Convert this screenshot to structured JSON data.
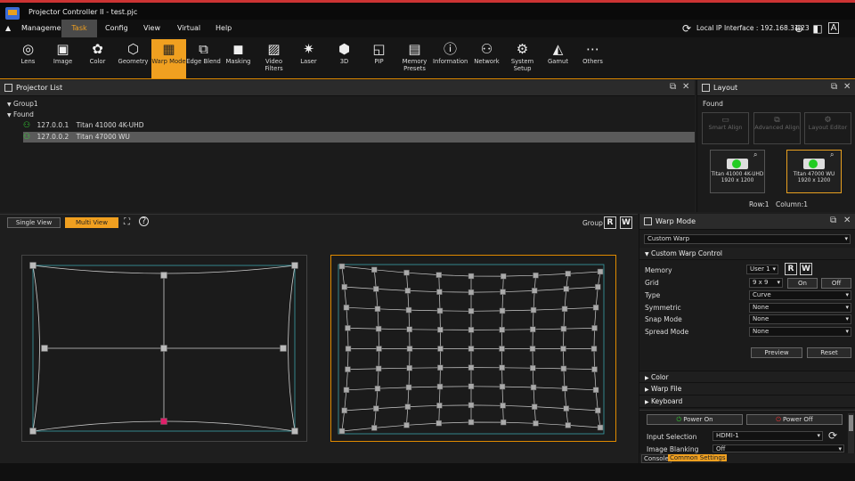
{
  "window": {
    "title": "Projector Controller II - test.pjc"
  },
  "menu": [
    "Management",
    "Task",
    "Config",
    "View",
    "Virtual",
    "Help"
  ],
  "header": {
    "ip_label": "Local IP Interface : 192.168.31.23"
  },
  "toolbar": [
    {
      "label": "Lens",
      "icon": "lens-icon",
      "glyph": "◎"
    },
    {
      "label": "Image",
      "icon": "image-icon",
      "glyph": "▣"
    },
    {
      "label": "Color",
      "icon": "color-icon",
      "glyph": "✿"
    },
    {
      "label": "Geometry",
      "icon": "geometry-icon",
      "glyph": "⬡"
    },
    {
      "label": "Warp Mode",
      "icon": "warp-icon",
      "glyph": "▦"
    },
    {
      "label": "Edge Blend",
      "icon": "edge-blend-icon",
      "glyph": "⧉"
    },
    {
      "label": "Masking",
      "icon": "masking-icon",
      "glyph": "◼"
    },
    {
      "label": "Video Filters",
      "icon": "video-filters-icon",
      "glyph": "▨"
    },
    {
      "label": "Laser",
      "icon": "laser-icon",
      "glyph": "✷"
    },
    {
      "label": "3D",
      "icon": "3d-icon",
      "glyph": "⬢"
    },
    {
      "label": "PIP",
      "icon": "pip-icon",
      "glyph": "◱"
    },
    {
      "label": "Memory Presets",
      "icon": "memory-presets-icon",
      "glyph": "▤"
    },
    {
      "label": "Information",
      "icon": "information-icon",
      "glyph": "ⓘ"
    },
    {
      "label": "Network",
      "icon": "network-icon",
      "glyph": "⚇"
    },
    {
      "label": "System Setup",
      "icon": "system-setup-icon",
      "glyph": "⚙"
    },
    {
      "label": "Gamut",
      "icon": "gamut-icon",
      "glyph": "◭"
    },
    {
      "label": "Others",
      "icon": "others-icon",
      "glyph": "⋯"
    }
  ],
  "projector_list": {
    "title": "Projector List",
    "group": "Group1",
    "found": "Found",
    "items": [
      {
        "ip": "127.0.0.1",
        "model": "Titan 41000 4K-UHD"
      },
      {
        "ip": "127.0.0.2",
        "model": "Titan 47000 WU"
      }
    ]
  },
  "layout": {
    "title": "Layout",
    "found": "Found",
    "buttons": [
      "Smart Align",
      "Advanced Align",
      "Layout Editor"
    ],
    "projectors": [
      {
        "name": "Titan 41000 4K-UHD",
        "res": "1920 x 1200"
      },
      {
        "name": "Titan 47000 WU",
        "res": "1920 x 1200"
      }
    ],
    "row": "Row:1",
    "column": "Column:1"
  },
  "view": {
    "single": "Single View",
    "multi": "Multi View",
    "group": "Group",
    "r": "R",
    "w": "W"
  },
  "warp": {
    "title": "Warp Mode",
    "mode": "Custom Warp",
    "section": "Custom Warp Control",
    "memory_label": "Memory",
    "memory_value": "User 1",
    "grid_label": "Grid",
    "grid_value": "9 x 9",
    "on": "On",
    "off": "Off",
    "type_label": "Type",
    "type_value": "Curve",
    "symmetric_label": "Symmetric",
    "symmetric_value": "None",
    "snap_label": "Snap Mode",
    "snap_value": "None",
    "spread_label": "Spread Mode",
    "spread_value": "None",
    "preview": "Preview",
    "reset": "Reset",
    "sections": [
      "Color",
      "Warp File",
      "Keyboard"
    ],
    "power_on": "Power On",
    "power_off": "Power Off",
    "input_label": "Input Selection",
    "input_value": "HDMI-1",
    "blank_label": "Image Blanking",
    "blank_value": "Off",
    "tab_console": "Console",
    "tab_common": "Common Settings"
  }
}
